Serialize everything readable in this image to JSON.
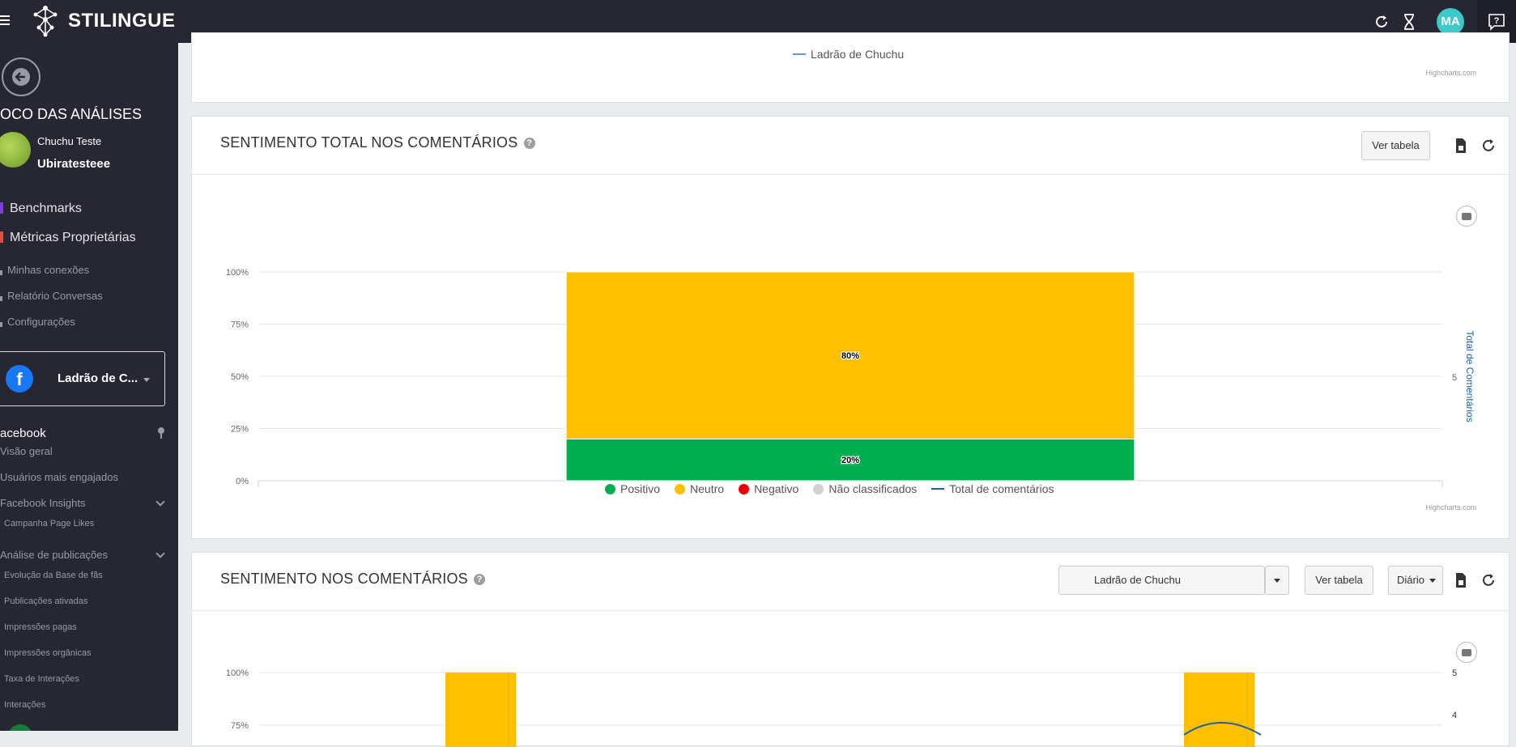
{
  "header": {
    "brand": "STILINGUE",
    "avatar_initials": "MA",
    "icons": [
      "hamburger-icon",
      "refresh-icon",
      "hourglass-icon",
      "help-icon"
    ],
    "colors": {
      "bar": "#272733",
      "avatar": "#3ec9c9"
    }
  },
  "sidebar": {
    "title": "OCO DAS ANÁLISES",
    "user_name": "Chuchu Teste",
    "account_name": "Ubiratesteee",
    "main_links": [
      {
        "label": "Benchmarks",
        "color": "#7b3fe4"
      },
      {
        "label": "Métricas Proprietárias",
        "color": "#e84c3d"
      }
    ],
    "sub_links": [
      "Minhas conexões",
      "Relatório Conversas",
      "Configurações"
    ],
    "page_selector": {
      "label": "Ladrão de C...",
      "fb_letter": "f"
    },
    "network": "acebook",
    "items": [
      {
        "label": "Visão geral",
        "level": "item"
      },
      {
        "label": "Usuários mais engajados",
        "level": "item"
      },
      {
        "label": "Facebook Insights",
        "level": "item",
        "expandable": true
      },
      {
        "label": "Campanha Page Likes",
        "level": "subitem"
      },
      {
        "label": "Análise de publicações",
        "level": "item",
        "expandable": true
      },
      {
        "label": "Evolução da Base de fãs",
        "level": "subitem"
      },
      {
        "label": "Publicações ativadas",
        "level": "subitem"
      },
      {
        "label": "Impressões pagas",
        "level": "subitem"
      },
      {
        "label": "Impressões orgânicas",
        "level": "subitem"
      },
      {
        "label": "Taxa de Interações",
        "level": "subitem"
      },
      {
        "label": "Interações",
        "level": "subitem"
      }
    ]
  },
  "top_card": {
    "legend_label": "Ladrão de Chuchu",
    "credit": "Highcharts.com"
  },
  "card1": {
    "title": "SENTIMENTO TOTAL NOS COMENTÁRIOS",
    "help": "?",
    "view_table": "Ver tabela",
    "credit": "Highcharts.com",
    "right_axis_label": "Total de Comentários",
    "legend": [
      {
        "label": "Positivo",
        "color": "#00b050",
        "kind": "dot"
      },
      {
        "label": "Neutro",
        "color": "#ffc000",
        "kind": "dot"
      },
      {
        "label": "Negativo",
        "color": "#ee0000",
        "kind": "dot"
      },
      {
        "label": "Não classificados",
        "color": "#d0d0d0",
        "kind": "dot"
      },
      {
        "label": "Total de comentários",
        "color": "#1f5fa8",
        "kind": "line"
      }
    ]
  },
  "card2": {
    "title": "SENTIMENTO NOS COMENTÁRIOS",
    "help": "?",
    "page_filter": "Ladrão de Chuchu",
    "view_table": "Ver tabela",
    "period": "Diário"
  },
  "chart_data": [
    {
      "type": "bar",
      "stacked": "percent",
      "categories": [
        "Ladrão de Chuchu"
      ],
      "series": [
        {
          "name": "Positivo",
          "values": [
            20
          ],
          "color": "#00b050",
          "label": "20%"
        },
        {
          "name": "Neutro",
          "values": [
            80
          ],
          "color": "#ffc000",
          "label": "80%"
        },
        {
          "name": "Negativo",
          "values": [
            0
          ],
          "color": "#ee0000"
        },
        {
          "name": "Não classificados",
          "values": [
            0
          ],
          "color": "#d0d0d0"
        }
      ],
      "y_ticks": [
        "100%",
        "75%",
        "50%",
        "25%",
        "0%"
      ],
      "ylim": [
        0,
        100
      ],
      "right_axis": {
        "label": "Total de Comentários",
        "ticks": [
          "5"
        ]
      },
      "grid": true,
      "legend_position": "bottom"
    },
    {
      "type": "bar",
      "stacked": "percent",
      "partial": true,
      "y_ticks": [
        "100%",
        "75%"
      ],
      "right_ticks": [
        "5",
        "4"
      ],
      "visible_bars": 2,
      "bar_color": "#ffc000"
    }
  ]
}
